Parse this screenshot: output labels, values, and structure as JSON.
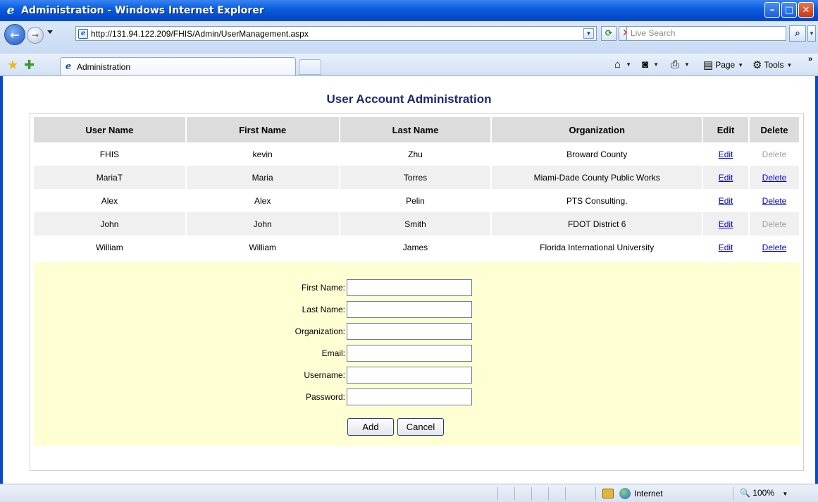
{
  "window": {
    "title": "Administration - Windows Internet Explorer",
    "logo": "ie-logo-icon"
  },
  "nav": {
    "url": "http://131.94.122.209/FHIS/Admin/UserManagement.aspx",
    "search_placeholder": "Live Search"
  },
  "tab": {
    "label": "Administration"
  },
  "commands": {
    "page": "Page",
    "tools": "Tools"
  },
  "page": {
    "title": "User Account Administration",
    "columns": [
      "User Name",
      "First Name",
      "Last Name",
      "Organization",
      "Edit",
      "Delete"
    ],
    "rows": [
      {
        "username": "FHIS",
        "first": "kevin",
        "last": "Zhu",
        "org": "Broward County",
        "edit": "Edit",
        "delete": "Delete",
        "delete_enabled": false
      },
      {
        "username": "MariaT",
        "first": "Maria",
        "last": "Torres",
        "org": "Miami-Dade County Public Works",
        "edit": "Edit",
        "delete": "Delete",
        "delete_enabled": true
      },
      {
        "username": "Alex",
        "first": "Alex",
        "last": "Pelin",
        "org": "PTS Consulting.",
        "edit": "Edit",
        "delete": "Delete",
        "delete_enabled": true
      },
      {
        "username": "John",
        "first": "John",
        "last": "Smith",
        "org": "FDOT District 6",
        "edit": "Edit",
        "delete": "Delete",
        "delete_enabled": false
      },
      {
        "username": "William",
        "first": "William",
        "last": "James",
        "org": "Florida International University",
        "edit": "Edit",
        "delete": "Delete",
        "delete_enabled": true
      }
    ],
    "form": {
      "first_name_label": "First Name:",
      "last_name_label": "Last Name:",
      "organization_label": "Organization:",
      "email_label": "Email:",
      "username_label": "Username:",
      "password_label": "Password:",
      "add_label": "Add",
      "cancel_label": "Cancel"
    }
  },
  "status": {
    "zone": "Internet",
    "zoom": "100%"
  },
  "colors": {
    "link": "#0000cc",
    "disabled": "#a0a0a0",
    "form_bg": "#ffffd4",
    "header_bg": "#dcdcdc",
    "title": "#1b2878"
  }
}
